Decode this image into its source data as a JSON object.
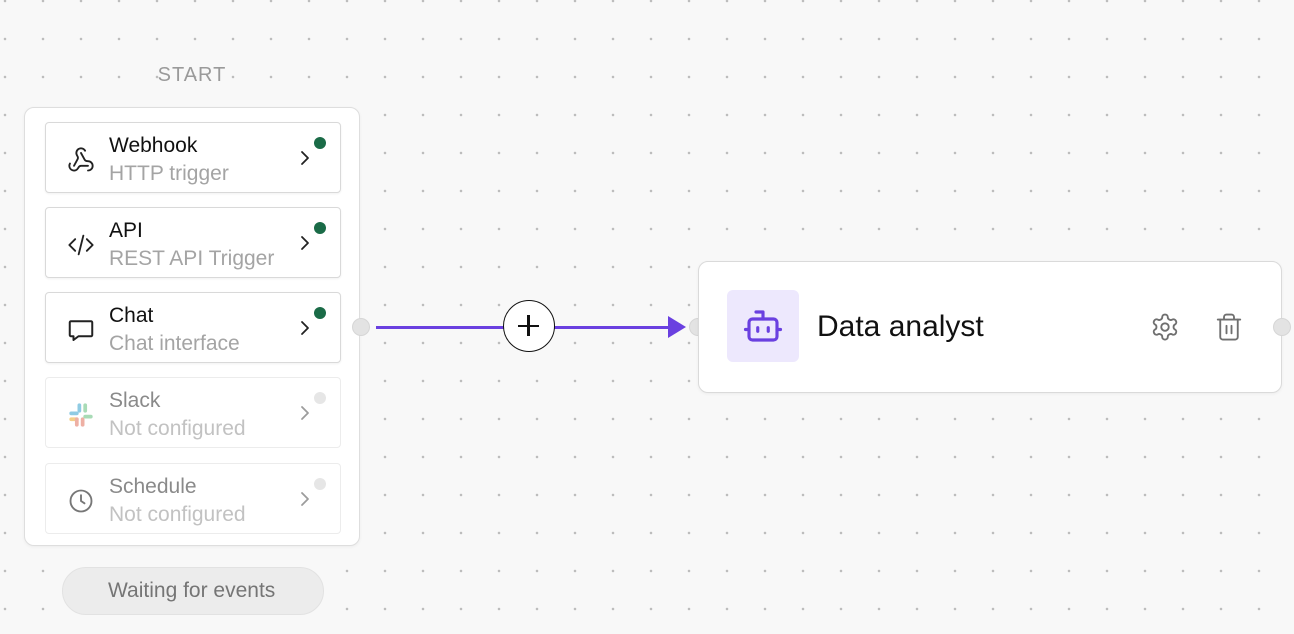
{
  "start": {
    "label": "START"
  },
  "triggers": [
    {
      "name": "Webhook",
      "description": "HTTP trigger",
      "icon": "webhook-icon",
      "status": "active",
      "status_color": "#1a6b47"
    },
    {
      "name": "API",
      "description": "REST API Trigger",
      "icon": "code-icon",
      "status": "active",
      "status_color": "#1a6b47"
    },
    {
      "name": "Chat",
      "description": "Chat interface",
      "icon": "chat-bubble-icon",
      "status": "active",
      "status_color": "#1a6b47"
    },
    {
      "name": "Slack",
      "description": "Not configured",
      "icon": "slack-icon",
      "status": "inactive",
      "status_color": "#e6e6e6"
    },
    {
      "name": "Schedule",
      "description": "Not configured",
      "icon": "clock-icon",
      "status": "inactive",
      "status_color": "#e6e6e6"
    }
  ],
  "edge": {
    "color": "#6a40e0",
    "add_icon": "plus-icon"
  },
  "agent_node": {
    "title": "Data analyst",
    "icon": "robot-icon",
    "icon_color": "#6a40e0",
    "icon_background": "#ede8fd",
    "actions": [
      "gear-icon",
      "trash-icon"
    ]
  },
  "status": {
    "waiting_text": "Waiting for events"
  }
}
